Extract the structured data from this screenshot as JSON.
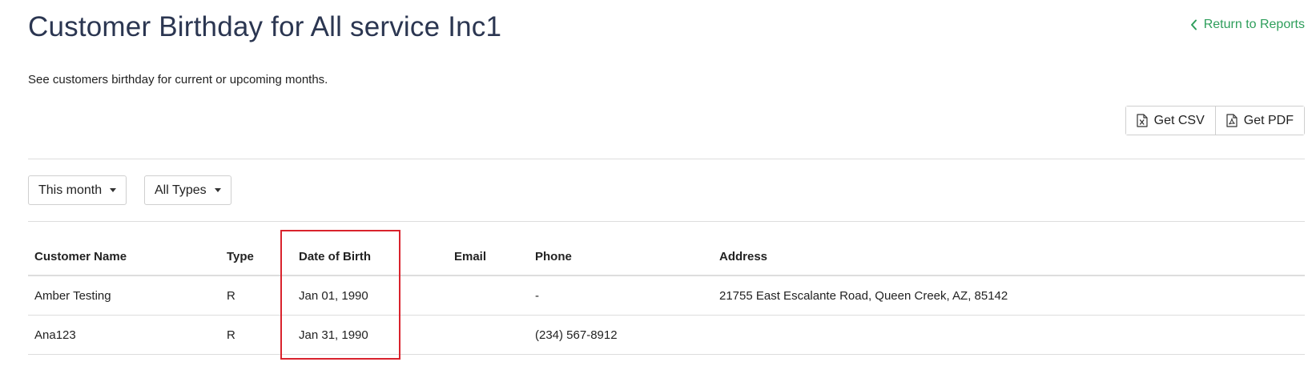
{
  "header": {
    "title": "Customer Birthday for All service Inc1",
    "return_link": "Return to Reports",
    "subtitle": "See customers birthday for current or upcoming months."
  },
  "export": {
    "csv_label": "Get CSV",
    "csv_icon": "file-excel-icon",
    "pdf_label": "Get PDF",
    "pdf_icon": "file-pdf-icon"
  },
  "filters": {
    "period": "This month",
    "type": "All Types"
  },
  "table": {
    "columns": {
      "name": "Customer Name",
      "type": "Type",
      "dob": "Date of Birth",
      "email": "Email",
      "phone": "Phone",
      "address": "Address"
    },
    "rows": [
      {
        "name": "Amber Testing",
        "type": "R",
        "dob": "Jan 01, 1990",
        "email": "",
        "phone": "-",
        "address": "21755 East Escalante Road, Queen Creek, AZ, 85142"
      },
      {
        "name": "Ana123",
        "type": "R",
        "dob": "Jan 31, 1990",
        "email": "",
        "phone": "(234) 567-8912",
        "address": ""
      }
    ]
  },
  "colors": {
    "title": "#2b3651",
    "link": "#2e9e5b",
    "highlight": "#d9232d",
    "border": "#dddddd"
  }
}
